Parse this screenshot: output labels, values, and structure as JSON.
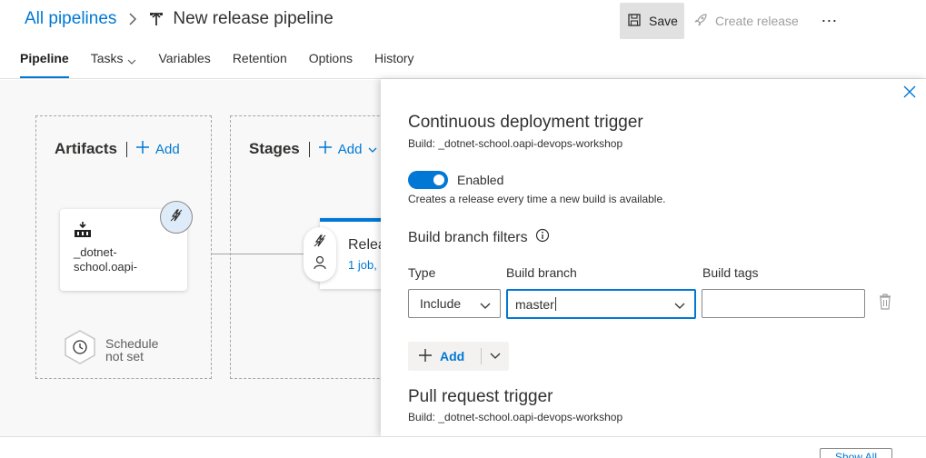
{
  "breadcrumb": {
    "root_link": "All pipelines",
    "title": "New release pipeline"
  },
  "toolbar": {
    "save_label": "Save",
    "create_release_label": "Create release",
    "more_label": "⋯"
  },
  "tabs": [
    {
      "label": "Pipeline",
      "active": true
    },
    {
      "label": "Tasks",
      "has_dropdown": true
    },
    {
      "label": "Variables"
    },
    {
      "label": "Retention"
    },
    {
      "label": "Options"
    },
    {
      "label": "History"
    }
  ],
  "canvas": {
    "artifacts": {
      "title": "Artifacts",
      "add_label": "Add",
      "card_name": "_dotnet-school.oapi-",
      "schedule_text_line1": "Schedule",
      "schedule_text_line2": "not set"
    },
    "stages": {
      "title": "Stages",
      "add_label": "Add",
      "stage_name": "Relea",
      "stage_sub": "1 job,"
    }
  },
  "panel": {
    "title": "Continuous deployment trigger",
    "subtitle": "Build: _dotnet-school.oapi-devops-workshop",
    "toggle_label": "Enabled",
    "toggle_on": true,
    "toggle_desc": "Creates a release every time a new build is available.",
    "filters_title": "Build branch filters",
    "columns": {
      "type": "Type",
      "branch": "Build branch",
      "tags": "Build tags"
    },
    "filter_row": {
      "type_value": "Include",
      "branch_value": "master",
      "tags_value": ""
    },
    "add_label": "Add",
    "pr_title": "Pull request trigger",
    "pr_subtitle": "Build: _dotnet-school.oapi-devops-workshop"
  },
  "bottom": {
    "show_all_label": "Show All"
  },
  "colors": {
    "accent": "#0078d4",
    "text": "#323130",
    "canvas_bg": "#f8f8f8"
  }
}
